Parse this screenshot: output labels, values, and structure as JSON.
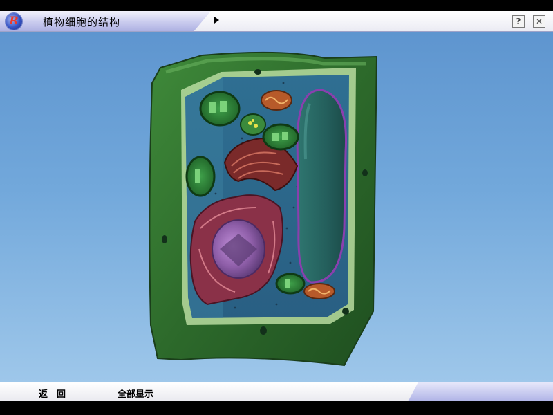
{
  "window": {
    "title": "植物细胞的结构"
  },
  "controls": {
    "help_label": "?",
    "close_label": "✕"
  },
  "footer": {
    "back_label": "返　回",
    "show_all_label": "全部显示"
  },
  "logo": {
    "letter": "R"
  },
  "colors": {
    "background": "#6fa4d8",
    "cell_wall": "#2e6a2a",
    "cytoplasm": "#2f6d93",
    "vacuole": "#2b6b66",
    "nucleus": "#8a3a5c",
    "nucleolus": "#b08ad0"
  }
}
